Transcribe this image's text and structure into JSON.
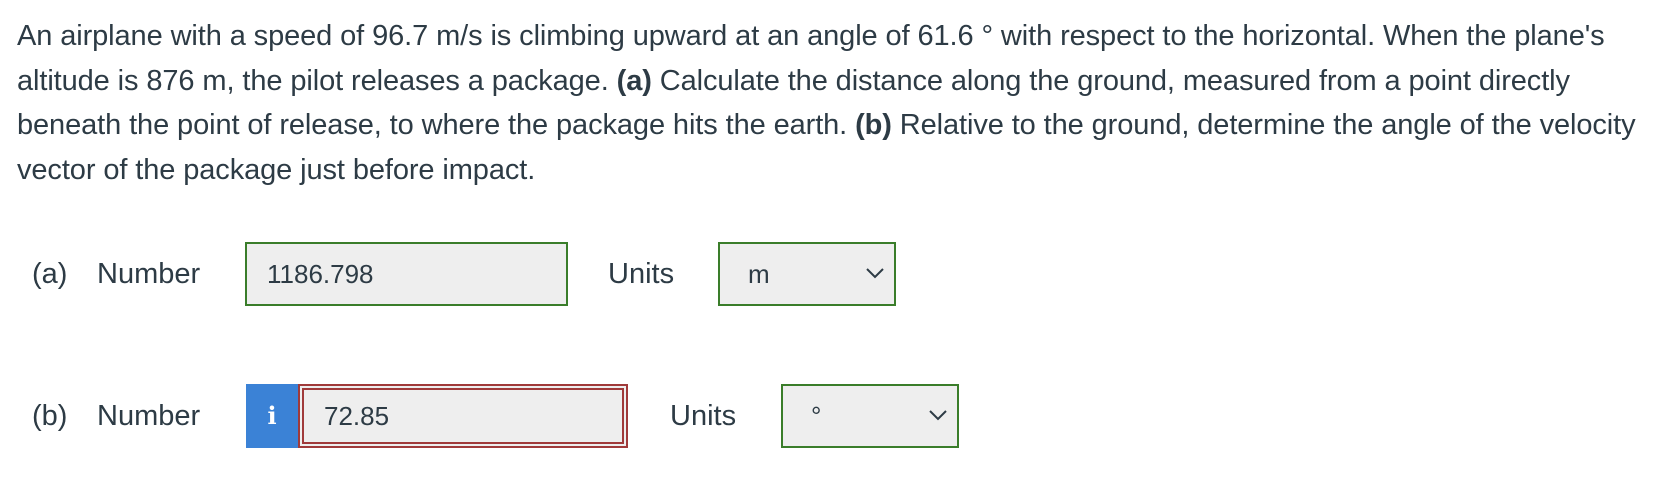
{
  "question": {
    "intro": "An airplane with a speed of 96.7 m/s is climbing upward at an angle of 61.6 ° with respect to the horizontal. When the plane's altitude is 876 m, the pilot releases a package. ",
    "part_a_tag": "(a)",
    "part_a_text": " Calculate the distance along the ground, measured from a point directly beneath the point of release, to where the package hits the earth. ",
    "part_b_tag": "(b)",
    "part_b_text": " Relative to the ground, determine the angle of the velocity vector of the package just before impact."
  },
  "answers": [
    {
      "part": "(a)",
      "number_label": "Number",
      "value": "1186.798",
      "units_label": "Units",
      "unit_value": "m",
      "status": "correct",
      "has_info_badge": false
    },
    {
      "part": "(b)",
      "number_label": "Number",
      "value": "72.85",
      "units_label": "Units",
      "unit_value": "°",
      "status": "incorrect",
      "has_info_badge": true,
      "info_badge_glyph": "i"
    }
  ],
  "colors": {
    "text": "#2d3b45",
    "correct_border": "#3a7d2a",
    "incorrect_border": "#a03a3a",
    "info_badge": "#3b82d6",
    "field_background": "#eeeeee"
  }
}
